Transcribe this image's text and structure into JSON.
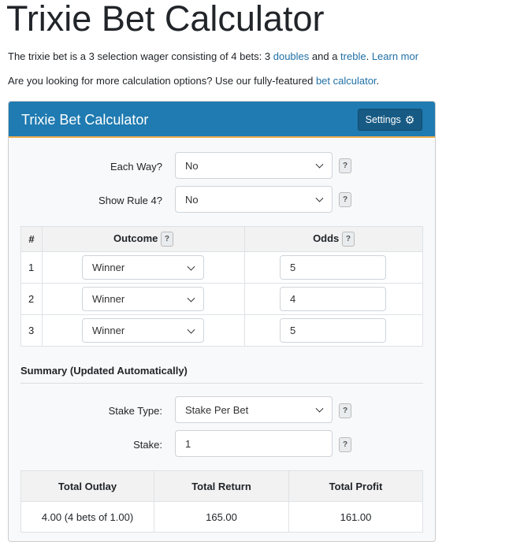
{
  "page": {
    "title": "Trixie Bet Calculator",
    "intro": {
      "t1": "The trixie bet is a 3 selection wager consisting of 4 bets: 3 ",
      "doubles": "doubles",
      "t2": " and a ",
      "treble": "treble",
      "t3": ". ",
      "learn": "Learn mor"
    },
    "options": {
      "t1": "Are you looking for more calculation options? Use our fully-featured ",
      "link": "bet calculator",
      "t2": "."
    }
  },
  "calculator": {
    "title": "Trixie Bet Calculator",
    "settings_label": "Settings",
    "settings_icon": "gear-icon",
    "each_way": {
      "label": "Each Way?",
      "value": "No"
    },
    "rule4": {
      "label": "Show Rule 4?",
      "value": "No"
    },
    "help": "?",
    "selections": {
      "headers": [
        "#",
        "Outcome",
        "Odds"
      ],
      "rows": [
        {
          "n": "1",
          "outcome": "Winner",
          "odds": "5"
        },
        {
          "n": "2",
          "outcome": "Winner",
          "odds": "4"
        },
        {
          "n": "3",
          "outcome": "Winner",
          "odds": "5"
        }
      ]
    },
    "summary": {
      "heading": "Summary (Updated Automatically)",
      "stake_type": {
        "label": "Stake Type:",
        "value": "Stake Per Bet"
      },
      "stake": {
        "label": "Stake:",
        "value": "1"
      },
      "headers": [
        "Total Outlay",
        "Total Return",
        "Total Profit"
      ],
      "values": [
        "4.00 (4 bets of 1.00)",
        "165.00",
        "161.00"
      ]
    }
  },
  "colors": {
    "header": "#1f7bb1",
    "accent": "#f0ad4e",
    "link": "#1f6fa6"
  }
}
